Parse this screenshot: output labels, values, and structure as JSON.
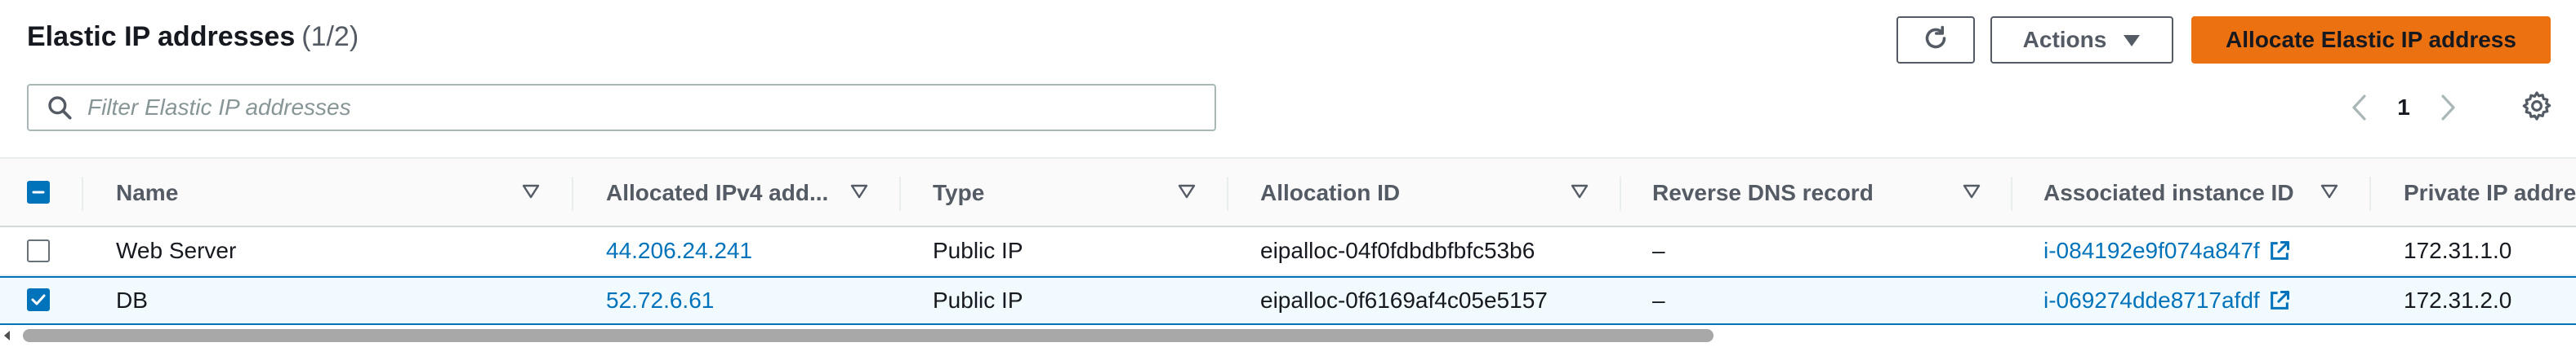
{
  "header": {
    "title": "Elastic IP addresses",
    "count": "(1/2)",
    "actions_label": "Actions",
    "allocate_label": "Allocate Elastic IP address"
  },
  "filter": {
    "placeholder": "Filter Elastic IP addresses",
    "value": ""
  },
  "pagination": {
    "page": "1"
  },
  "table": {
    "columns": [
      "Name",
      "Allocated IPv4 add...",
      "Type",
      "Allocation ID",
      "Reverse DNS record",
      "Associated instance ID",
      "Private IP address"
    ],
    "rows": [
      {
        "selected": false,
        "name": "Web Server",
        "ipv4": "44.206.24.241",
        "type": "Public IP",
        "allocation_id": "eipalloc-04f0fdbdbfbfc53b6",
        "reverse_dns": "–",
        "instance_id": "i-084192e9f074a847f",
        "private_ip": "172.31.1.0"
      },
      {
        "selected": true,
        "name": "DB",
        "ipv4": "52.72.6.61",
        "type": "Public IP",
        "allocation_id": "eipalloc-0f6169af4c05e5157",
        "reverse_dns": "–",
        "instance_id": "i-069274dde8717afdf",
        "private_ip": "172.31.2.0"
      }
    ]
  },
  "colors": {
    "primary": "#ec7211",
    "link": "#0073bb",
    "selected_bg": "#f1faff"
  },
  "icons": [
    "refresh-icon",
    "caret-down-icon",
    "search-icon",
    "chevron-left-icon",
    "chevron-right-icon",
    "gear-icon",
    "sort-icon",
    "external-link-icon",
    "checkbox-indeterminate-icon",
    "checkmark-icon"
  ]
}
